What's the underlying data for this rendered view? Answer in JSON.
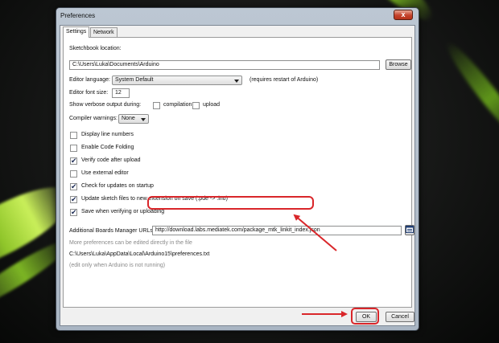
{
  "window": {
    "title": "Preferences",
    "close_label": "x"
  },
  "tabs": [
    {
      "label": "Settings",
      "active": true
    },
    {
      "label": "Network",
      "active": false
    }
  ],
  "settings": {
    "sketchbook_label": "Sketchbook location:",
    "sketchbook_path": "C:\\Users\\Luka\\Documents\\Arduino",
    "browse_label": "Browse",
    "language_label": "Editor language:",
    "language_value": "System Default",
    "language_note": "(requires restart of Arduino)",
    "font_size_label": "Editor font size:",
    "font_size_value": "12",
    "verbose_label": "Show verbose output during:",
    "verbose_compilation": {
      "label": "compilation",
      "checked": false
    },
    "verbose_upload": {
      "label": "upload",
      "checked": false
    },
    "warnings_label": "Compiler warnings:",
    "warnings_value": "None",
    "options": [
      {
        "label": "Display line numbers",
        "checked": false
      },
      {
        "label": "Enable Code Folding",
        "checked": false
      },
      {
        "label": "Verify code after upload",
        "checked": true
      },
      {
        "label": "Use external editor",
        "checked": false
      },
      {
        "label": "Check for updates on startup",
        "checked": true
      },
      {
        "label": "Update sketch files to new extension on save (.pde -> .ino)",
        "checked": true
      },
      {
        "label": "Save when verifying or uploading",
        "checked": true
      }
    ],
    "boards_url_label": "Additional Boards Manager URLs:",
    "boards_url_value": "http://download.labs.mediatek.com/package_mtk_linkit_index.json",
    "more_prefs_note": "More preferences can be edited directly in the file",
    "prefs_file_path": "C:\\Users\\Luka\\AppData\\Local\\Arduino15\\preferences.txt",
    "edit_note": "(edit only when Arduino is not running)"
  },
  "footer": {
    "ok_label": "OK",
    "cancel_label": "Cancel"
  },
  "colors": {
    "annotation_red": "#d9262a",
    "accent_green": "#8fc52a"
  },
  "icons": {
    "url_list_button": "window-list-icon",
    "check": "checkmark-icon"
  }
}
